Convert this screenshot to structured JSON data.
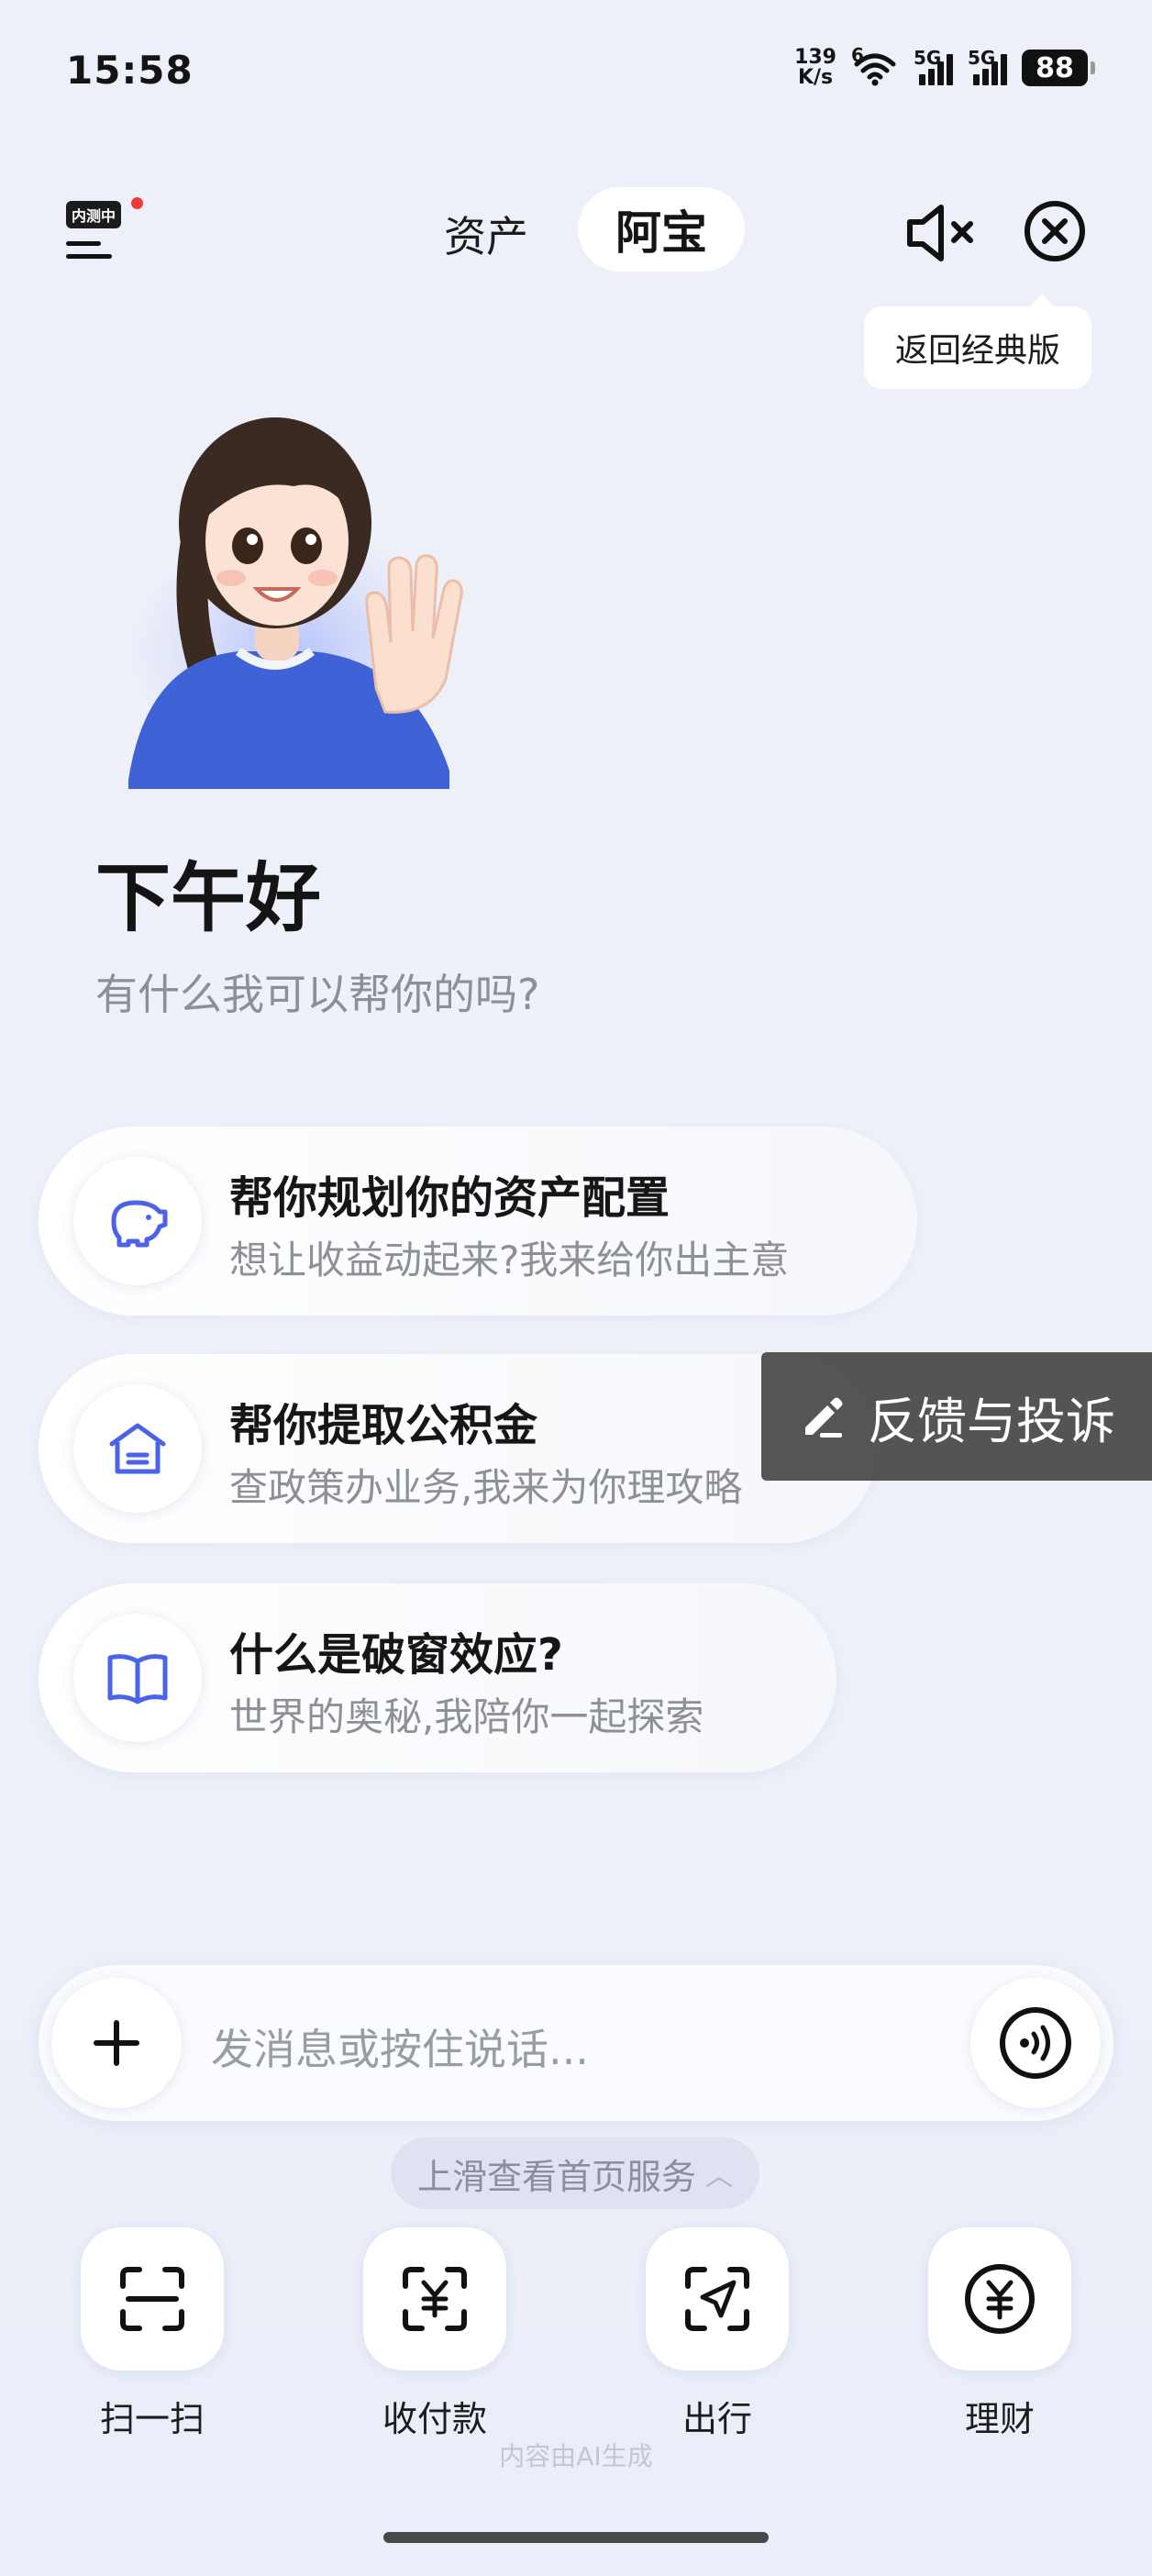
{
  "status_bar": {
    "time": "15:58",
    "net_speed_value": "139",
    "net_speed_unit": "K/s",
    "wifi_tag": "6",
    "sig1_tag": "5G",
    "sig2_tag": "5G",
    "battery": "88"
  },
  "header": {
    "beta_badge": "内测中",
    "tab_assets": "资产",
    "tab_abao": "阿宝",
    "tooltip": "返回经典版"
  },
  "hero": {
    "greeting": "下午好",
    "subtitle": "有什么我可以帮你的吗?"
  },
  "suggestions": [
    {
      "title": "帮你规划你的资产配置",
      "subtitle": "想让收益动起来?我来给你出主意",
      "icon": "piggy-bank-icon"
    },
    {
      "title": "帮你提取公积金",
      "subtitle": "查政策办业务,我来为你理攻略",
      "icon": "house-icon"
    },
    {
      "title": "什么是破窗效应?",
      "subtitle": "世界的奥秘,我陪你一起探索",
      "icon": "book-icon"
    }
  ],
  "feedback": {
    "label": "反馈与投诉"
  },
  "input": {
    "placeholder": "发消息或按住说话..."
  },
  "swipe_hint": "上滑查看首页服务",
  "shortcuts": [
    {
      "label": "扫一扫",
      "icon": "scan-icon"
    },
    {
      "label": "收付款",
      "icon": "payment-icon"
    },
    {
      "label": "出行",
      "icon": "travel-icon"
    },
    {
      "label": "理财",
      "icon": "wealth-icon"
    }
  ],
  "ai_note": "内容由AI生成",
  "colors": {
    "accent_blue": "#4a63e8",
    "background": "#edf0f8"
  }
}
